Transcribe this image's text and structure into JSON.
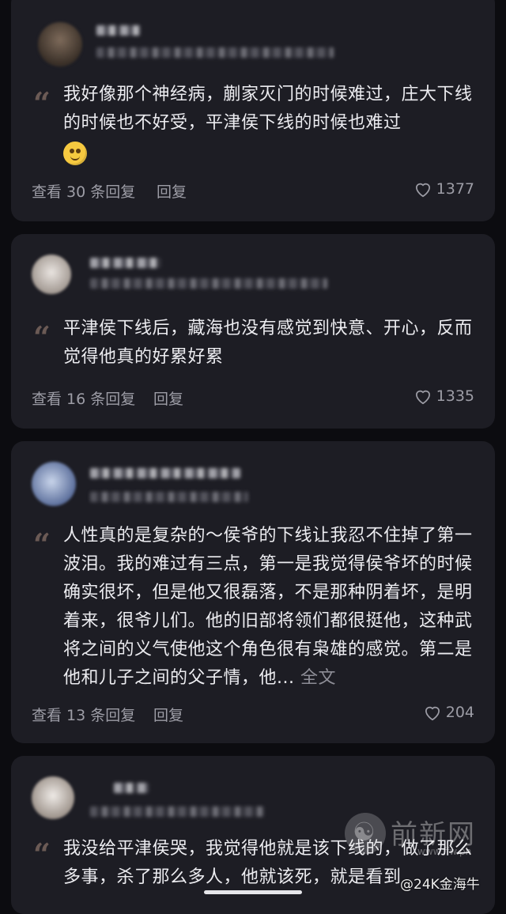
{
  "comments": [
    {
      "text": "我好像那个神经病，蒯家灭门的时候难过，庄大下线的时候也不好受，平津侯下线的时候也难过",
      "has_emoji": true,
      "view_replies": "查看 30 条回复",
      "reply": "回复",
      "likes": "1377"
    },
    {
      "text": "平津侯下线后，藏海也没有感觉到快意、开心，反而觉得他真的好累好累",
      "view_replies": "查看 16 条回复",
      "reply": "回复",
      "likes": "1335"
    },
    {
      "text": "人性真的是复杂的～侯爷的下线让我忍不住掉了第一波泪。我的难过有三点，第一是我觉得侯爷坏的时候确实很坏，但是他又很磊落，不是那种阴着坏，是明着来，很爷儿们。他的旧部将领们都很挺他，这种武将之间的义气使他这个角色很有枭雄的感觉。第二是他和儿子之间的父子情，他...",
      "more": " 全文",
      "view_replies": "查看 13 条回复",
      "reply": "回复",
      "likes": "204"
    },
    {
      "text": "我没给平津侯哭，我觉得他就是该下线的，做了那么多事，杀了那么多人，他就该死，就是看到"
    }
  ],
  "watermark": {
    "text": "前新网",
    "url": "www.ffw.ph"
  },
  "credit": "@24K金海牛",
  "colors": {
    "background": "#0c0c10",
    "card": "#1d1d24",
    "text": "#ececf0",
    "muted": "#9d9da6"
  }
}
